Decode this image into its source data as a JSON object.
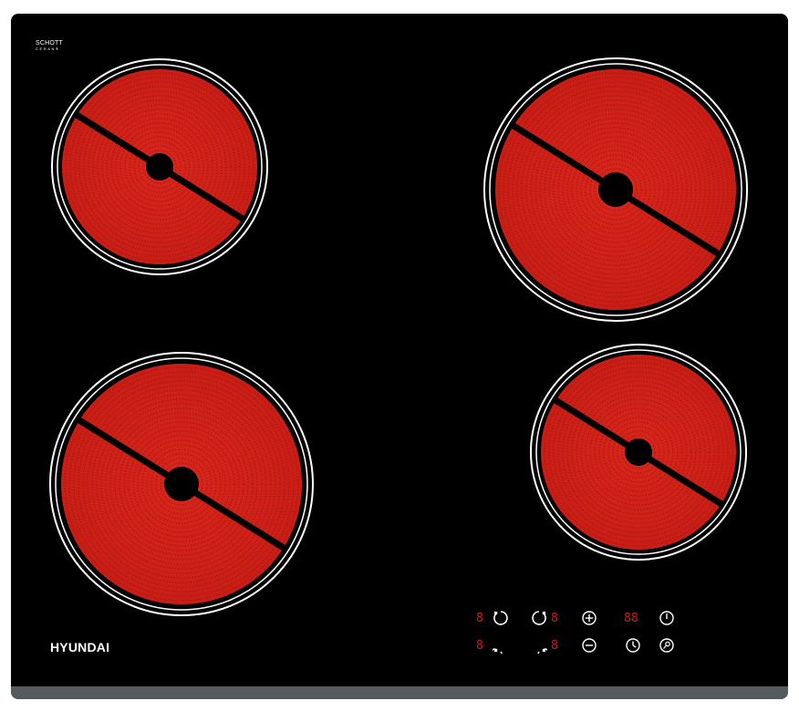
{
  "product": {
    "brand": "HYUNDAI",
    "glass_logo_line1": "SCHOTT",
    "glass_logo_line2": "CERAN®",
    "colors": {
      "glass": "#000000",
      "heating_coil": "#d8261c",
      "coil_dark": "#a4150f",
      "ring": "#ffffff",
      "frame": "#555b5d",
      "display_digit": "#d41a1a"
    }
  },
  "burners": [
    {
      "name": "rear-left",
      "size": "small"
    },
    {
      "name": "rear-right",
      "size": "large"
    },
    {
      "name": "front-left",
      "size": "large"
    },
    {
      "name": "front-right",
      "size": "small"
    }
  ],
  "control_panel": {
    "zone_displays": [
      "8",
      "8",
      "8",
      "8"
    ],
    "timer_display": "88",
    "icons": [
      "rear-left-zone-icon",
      "front-left-zone-icon",
      "rear-right-zone-icon",
      "front-right-zone-icon",
      "plus-icon",
      "minus-icon",
      "power-icon",
      "timer-icon",
      "lock-icon"
    ]
  }
}
